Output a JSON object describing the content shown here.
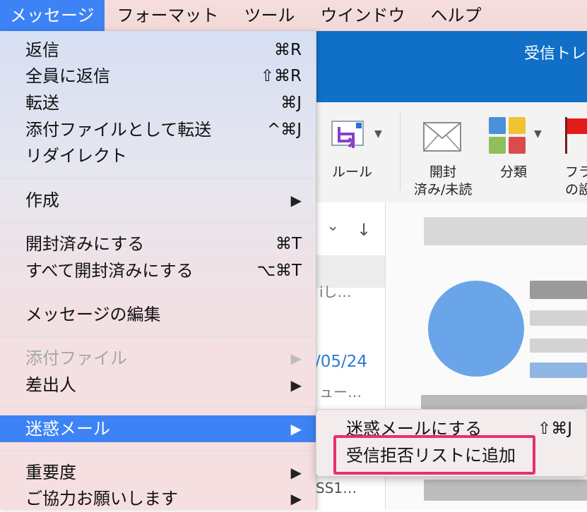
{
  "menubar": {
    "items": [
      "メッセージ",
      "フォーマット",
      "ツール",
      "ウインドウ",
      "ヘルプ"
    ]
  },
  "app": {
    "title": "受信トレ",
    "ribbon": {
      "rule_label": "ルール",
      "read_unread_line1": "開封",
      "read_unread_line2": "済み/未読",
      "categorize_label": "分類",
      "flag_line1": "フラ",
      "flag_line2": "の設"
    },
    "list": {
      "date_text": "/05/24",
      "snippet1": "iし…",
      "snippet2": "ュー…",
      "snippet3": "SS1…",
      "sort_down_arrow": "↓",
      "sort_chevron": "⌄"
    }
  },
  "menu": {
    "reply": {
      "label": "返信",
      "shortcut": "⌘R"
    },
    "reply_all": {
      "label": "全員に返信",
      "shortcut": "⇧⌘R"
    },
    "forward": {
      "label": "転送",
      "shortcut": "⌘J"
    },
    "forward_attachment": {
      "label": "添付ファイルとして転送",
      "shortcut": "^⌘J"
    },
    "redirect": {
      "label": "リダイレクト"
    },
    "compose": {
      "label": "作成"
    },
    "mark_read": {
      "label": "開封済みにする",
      "shortcut": "⌘T"
    },
    "mark_all_read": {
      "label": "すべて開封済みにする",
      "shortcut": "⌥⌘T"
    },
    "edit_message": {
      "label": "メッセージの編集"
    },
    "attachments": {
      "label": "添付ファイル"
    },
    "sender": {
      "label": "差出人"
    },
    "junk": {
      "label": "迷惑メール"
    },
    "priority": {
      "label": "重要度"
    },
    "please_help": {
      "label": "ご協力お願いします"
    }
  },
  "submenu": {
    "mark_junk": {
      "label": "迷惑メールにする",
      "shortcut": "⇧⌘J"
    },
    "block_sender": {
      "label": "受信拒否リストに追加"
    }
  },
  "colors": {
    "accent": "#3d83f5",
    "app_header": "#1070c7",
    "highlight_box": "#e8306f"
  }
}
